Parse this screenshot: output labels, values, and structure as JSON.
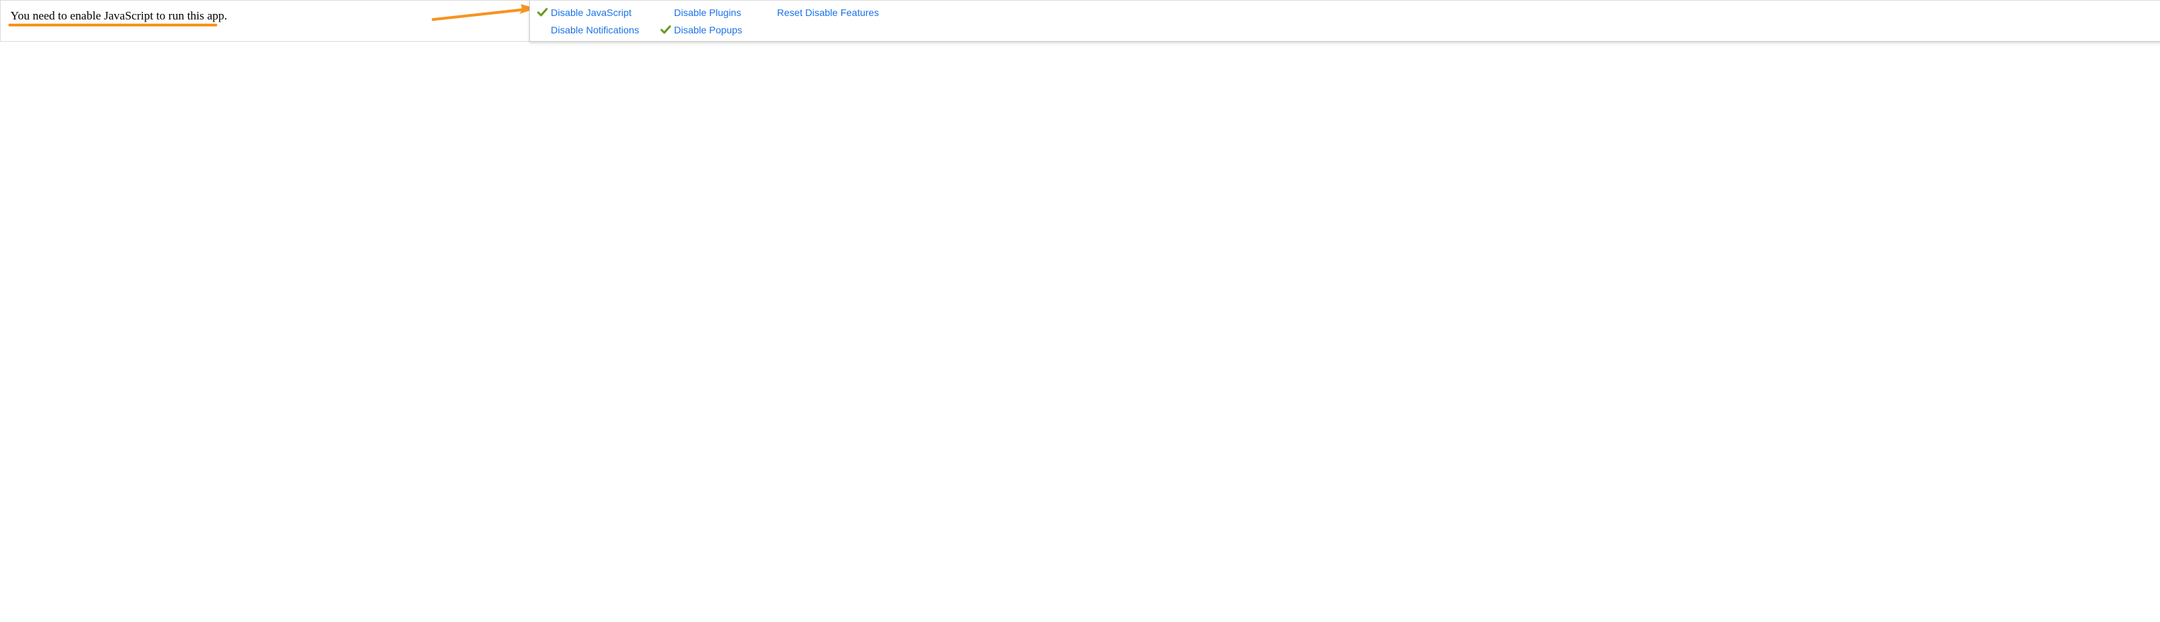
{
  "page": {
    "message": "You need to enable JavaScript to run this app."
  },
  "annotation": {
    "underline_color": "#f5941f",
    "arrow_color": "#f5941f"
  },
  "devtools": {
    "items": {
      "disable_javascript": {
        "label": "Disable JavaScript",
        "checked": true
      },
      "disable_notifications": {
        "label": "Disable Notifications",
        "checked": false
      },
      "disable_plugins": {
        "label": "Disable Plugins",
        "checked": false
      },
      "disable_popups": {
        "label": "Disable Popups",
        "checked": true
      },
      "reset_disable_features": {
        "label": "Reset Disable Features",
        "checked": false
      }
    }
  }
}
